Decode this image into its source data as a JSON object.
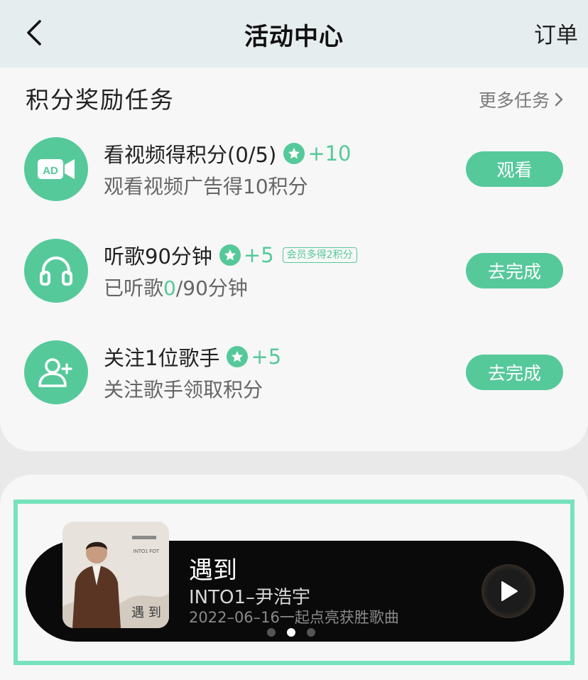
{
  "header": {
    "title": "活动中心",
    "right_label": "订单",
    "back_icon": "chevron-left-icon"
  },
  "tasks_section": {
    "title": "积分奖励任务",
    "more_label": "更多任务",
    "accent_color": "#56c99b",
    "tasks": [
      {
        "name": "看视频得积分(0/5)",
        "points": "+10",
        "desc": "观看视频广告得10积分",
        "button": "观看",
        "icon": "ad-video-icon"
      },
      {
        "name": "听歌90分钟",
        "points": "+5",
        "badge": "会员多得2积分",
        "desc_prefix": "已听歌",
        "desc_highlight": "0",
        "desc_suffix": "/90分钟",
        "button": "去完成",
        "icon": "headphones-icon"
      },
      {
        "name": "关注1位歌手",
        "points": "+5",
        "desc": "关注歌手领取积分",
        "button": "去完成",
        "icon": "follow-user-icon"
      }
    ]
  },
  "banner": {
    "song_title": "遇到",
    "artist": "INTO1–尹浩宇",
    "subtitle": "2022–06–16一起点亮获胜歌曲",
    "cover_text": "遇 到",
    "cover_brand": "INTO1 FOT",
    "carousel": {
      "count": 3,
      "active": 2
    }
  }
}
